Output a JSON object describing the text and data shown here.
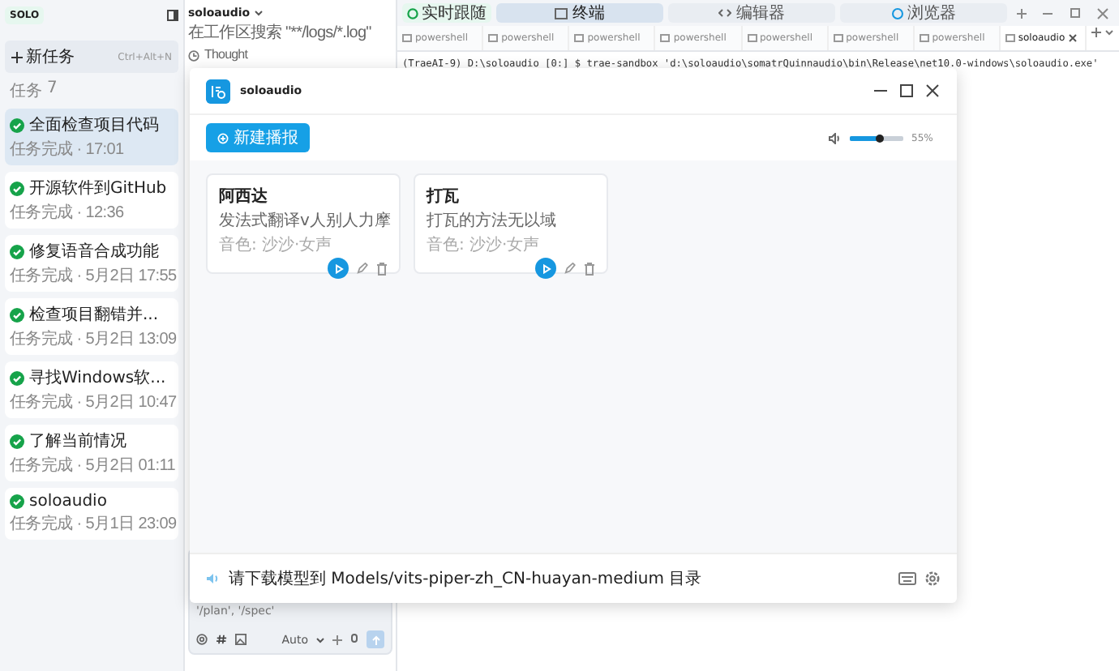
{
  "sidebar": {
    "logo": "SOLO",
    "new_task": {
      "label": "新任务",
      "shortcut": "Ctrl+Alt+N"
    },
    "section": {
      "label": "任务",
      "count": "7"
    },
    "tasks": [
      {
        "title": "全面检查项目代码",
        "subtitle": "任务完成 · 17:01",
        "selected": true
      },
      {
        "title": "开源软件到GitHub",
        "subtitle": "任务完成 · 12:36",
        "selected": false
      },
      {
        "title": "修复语音合成功能",
        "subtitle": "任务完成 · 5月2日 17:55",
        "selected": false
      },
      {
        "title": "检查项目翻错并...",
        "subtitle": "任务完成 · 5月2日 13:09",
        "selected": false
      },
      {
        "title": "寻找Windows软...",
        "subtitle": "任务完成 · 5月2日 10:47",
        "selected": false
      },
      {
        "title": "了解当前情况",
        "subtitle": "任务完成 · 5月2日 01:11",
        "selected": false
      },
      {
        "title": "soloaudio",
        "subtitle": "任务完成 · 5月1日 23:09",
        "selected": false
      }
    ]
  },
  "chat": {
    "project": "soloaudio",
    "lines": [
      {
        "kind": "search",
        "text": "在工作区搜索 \"**/logs/*.log\""
      },
      {
        "kind": "thought",
        "text": "Thought"
      }
    ],
    "input": {
      "hint": "'/plan', '/spec'",
      "mode": "Auto"
    }
  },
  "terminal": {
    "follow_button": "实时跟随",
    "top_tabs": [
      {
        "kind": "terminal",
        "label": "终端",
        "selected": true
      },
      {
        "kind": "editor",
        "label": "编辑器",
        "selected": false
      },
      {
        "kind": "browser",
        "label": "浏览器",
        "selected": false
      }
    ],
    "tabs": [
      {
        "label": "powershell",
        "selected": false
      },
      {
        "label": "powershell",
        "selected": false
      },
      {
        "label": "powershell",
        "selected": false
      },
      {
        "label": "powershell",
        "selected": false
      },
      {
        "label": "powershell",
        "selected": false
      },
      {
        "label": "powershell",
        "selected": false
      },
      {
        "label": "powershell",
        "selected": false
      },
      {
        "label": "soloaudio",
        "selected": true
      }
    ],
    "lines": [
      "(TraeAI-9) D:\\soloaudio [0:] $ trae-sandbox 'd:\\soloaudio\\somatrQuinnaudio\\bin\\Release\\net10.0-windows\\soloaudio.exe'"
    ]
  },
  "dialog": {
    "title": "soloaudio",
    "new_button": "新建播报",
    "volume": {
      "level": 0.55,
      "reading": "55%"
    },
    "cards": [
      {
        "title": "阿西达",
        "description": "发法式翻译v人别人力摩",
        "voice": "音色: 沙沙·女声"
      },
      {
        "title": "打瓦",
        "description": "打瓦的方法无以域",
        "voice": "音色: 沙沙·女声"
      }
    ],
    "status": "请下载模型到 Models/vits-piper-zh_CN-huayan-medium 目录"
  }
}
